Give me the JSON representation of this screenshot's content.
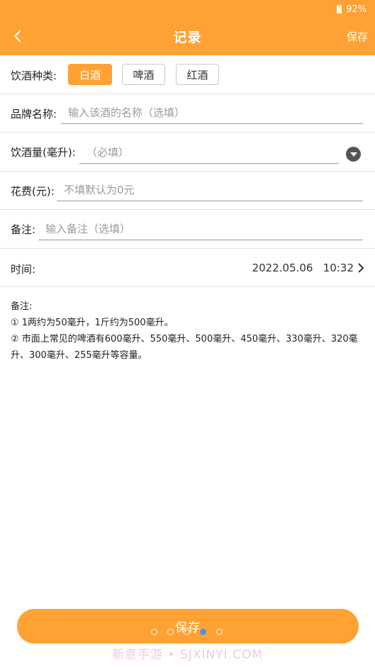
{
  "status_bar": {
    "battery": "92%"
  },
  "header": {
    "title": "记录",
    "save_label": "保存"
  },
  "drink_type": {
    "label": "饮酒种类:",
    "options": [
      {
        "label": "白酒",
        "selected": true
      },
      {
        "label": "啤酒",
        "selected": false
      },
      {
        "label": "红酒",
        "selected": false
      }
    ]
  },
  "brand": {
    "label": "品牌名称:",
    "placeholder": "输入该酒的名称（选填）"
  },
  "amount": {
    "label": "饮酒量(毫升):",
    "placeholder": "（必填）"
  },
  "cost": {
    "label": "花费(元):",
    "placeholder": "不填默认为0元"
  },
  "remark": {
    "label": "备注:",
    "placeholder": "输入备注（选填）"
  },
  "time": {
    "label": "时间:",
    "value": "2022.05.06   10:32"
  },
  "notes": {
    "title": "备注:",
    "line1": "① 1两约为50毫升，1斤约为500毫升。",
    "line2": "② 市面上常见的啤酒有600毫升、550毫升、500毫升、450毫升、330毫升、320毫升、300毫升、255毫升等容量。"
  },
  "bottom": {
    "save_label": "保存"
  },
  "watermark": "新意手游 • SJXINYI.COM",
  "colors": {
    "accent": "#ffa233",
    "divider": "#e4e4e4"
  }
}
